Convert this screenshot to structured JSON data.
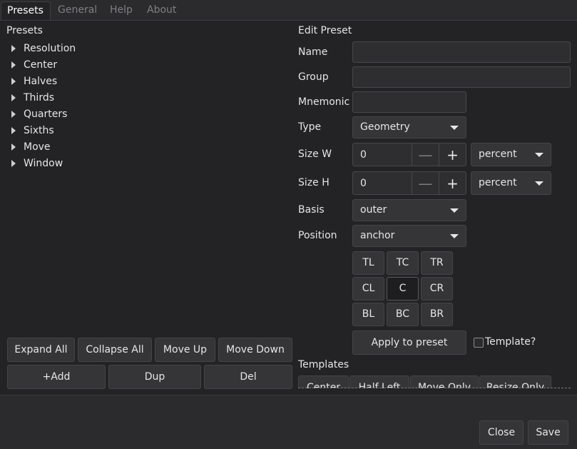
{
  "tabs": [
    "Presets",
    "General",
    "Help",
    "About"
  ],
  "presets_panel": {
    "heading": "Presets",
    "items": [
      "Resolution",
      "Center",
      "Halves",
      "Thirds",
      "Quarters",
      "Sixths",
      "Move",
      "Window"
    ]
  },
  "buttons": {
    "expand_all": "Expand All",
    "collapse_all": "Collapse All",
    "move_up": "Move Up",
    "move_down": "Move Down",
    "add": "+Add",
    "dup": "Dup",
    "del": "Del"
  },
  "edit": {
    "heading": "Edit Preset",
    "name_label": "Name",
    "group_label": "Group",
    "mnemonic_label": "Mnemonic",
    "type_label": "Type",
    "type_value": "Geometry",
    "size_w_label": "Size W",
    "size_w_value": "0",
    "size_w_unit": "percent",
    "size_h_label": "Size H",
    "size_h_value": "0",
    "size_h_unit": "percent",
    "basis_label": "Basis",
    "basis_value": "outer",
    "position_label": "Position",
    "position_value": "anchor",
    "minus": "—",
    "plus": "+",
    "anchors": [
      "TL",
      "TC",
      "TR",
      "CL",
      "C",
      "CR",
      "BL",
      "BC",
      "BR"
    ],
    "selected_anchor": "C",
    "apply": "Apply to preset",
    "template_check": "Template?"
  },
  "templates": {
    "heading": "Templates",
    "items": [
      "Center",
      "Half Left",
      "Move Only",
      "Resize Only"
    ]
  },
  "footer": {
    "close": "Close",
    "save": "Save"
  }
}
